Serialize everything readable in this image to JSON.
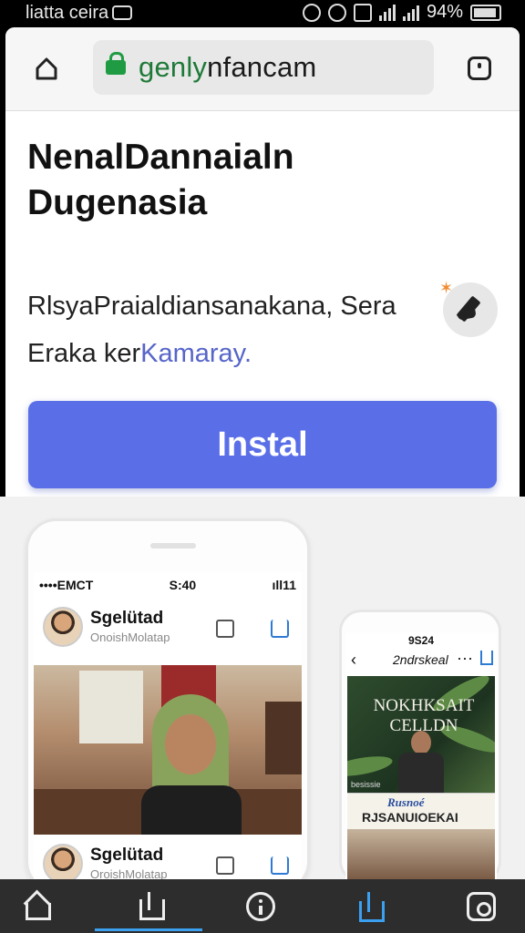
{
  "statusbar": {
    "left_text": "liatta ceira",
    "battery": "94%"
  },
  "browser": {
    "url_prefix": "genly",
    "url_suffix": "nfancam",
    "lock_color": "#1f9c43"
  },
  "page": {
    "title": "NenalDannaialn Dugenasia",
    "description_main": "RlsyaPraialdiansanakana, Sera Eraka ker",
    "description_link": "Kamaray.",
    "install_label": "Instal",
    "accent": "#5a6ee8"
  },
  "preview_big": {
    "status_left": "••••EMCT",
    "status_time": "S:40",
    "status_right": "ıll11",
    "post1_name": "Sgelütad",
    "post1_sub": "OnoishMolatap",
    "post2_name": "Sgelütad",
    "post2_sub": "OroishMolatap"
  },
  "preview_small": {
    "time": "9S24",
    "nav_name": "2ndrskeal",
    "card_heading": "NOKHKSAIT CELLDN",
    "card_tag": "besissie",
    "strip_script": "Rusnoé",
    "strip_title": "RJSANUIOEKAI"
  },
  "bottomnav": {
    "active_color": "#3aa0ef",
    "icons": [
      "home-icon",
      "share-icon",
      "info-icon",
      "upload-icon",
      "tabs-icon"
    ]
  }
}
